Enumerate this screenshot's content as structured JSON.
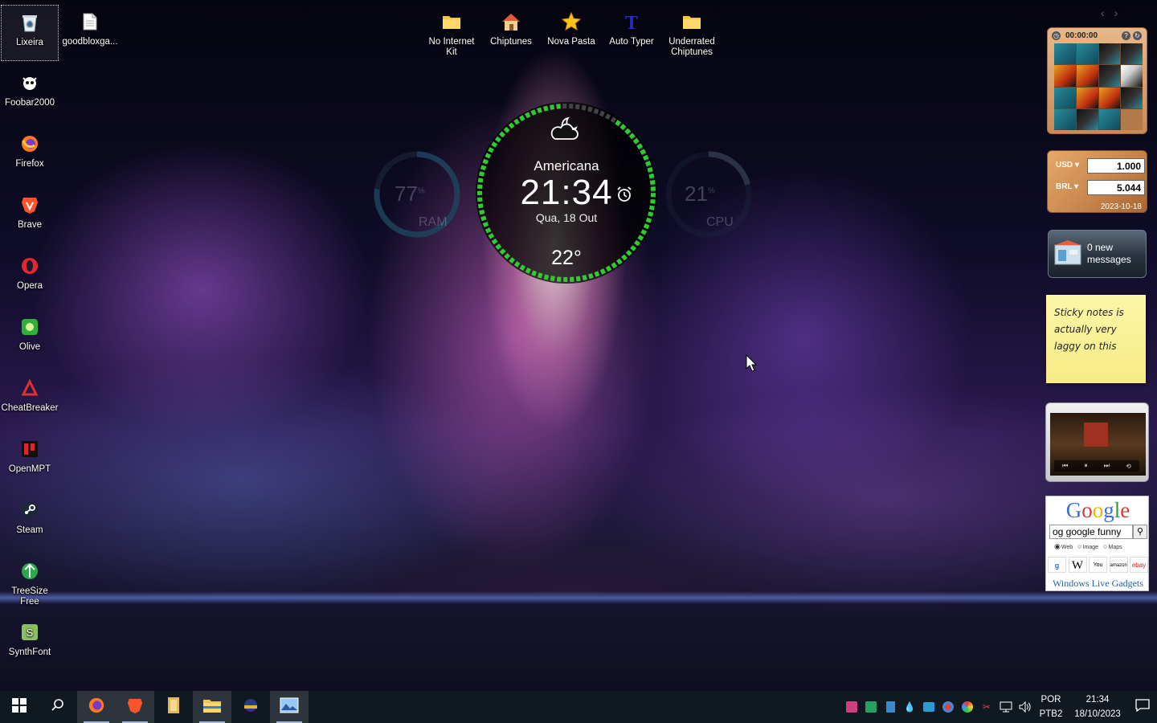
{
  "desktop_icons": [
    {
      "label": "Lixeira",
      "icon": "recycle-bin-icon"
    },
    {
      "label": "goodbloxga...",
      "icon": "file-icon"
    },
    {
      "label": "Foobar2000",
      "icon": "foobar-icon"
    },
    {
      "label": "Firefox",
      "icon": "firefox-icon"
    },
    {
      "label": "Brave",
      "icon": "brave-icon"
    },
    {
      "label": "Opera",
      "icon": "opera-icon"
    },
    {
      "label": "Olive",
      "icon": "olive-icon"
    },
    {
      "label": "CheatBreaker",
      "icon": "cheatbreaker-icon"
    },
    {
      "label": "OpenMPT",
      "icon": "openmpt-icon"
    },
    {
      "label": "Steam",
      "icon": "steam-icon"
    },
    {
      "label": "TreeSize Free",
      "icon": "treesize-icon"
    },
    {
      "label": "SynthFont",
      "icon": "synthfont-icon"
    },
    {
      "label": "No Internet Kit",
      "icon": "folder-icon"
    },
    {
      "label": "Chiptunes",
      "icon": "home-folder-icon"
    },
    {
      "label": "Nova Pasta",
      "icon": "star-icon"
    },
    {
      "label": "Auto Typer",
      "icon": "auto-typer-icon"
    },
    {
      "label": "Underrated Chiptunes",
      "icon": "folder-icon"
    }
  ],
  "clock_widget": {
    "city": "Americana",
    "time": "21:34",
    "date": "Qua, 18 Out",
    "temperature": "22°",
    "weather_icon": "partly-cloudy-night-icon",
    "ring_color": "#2ecc2e"
  },
  "ram_meter": {
    "value": "77",
    "unit": "%",
    "label": "RAM",
    "percent": 77
  },
  "cpu_meter": {
    "value": "21",
    "unit": "%",
    "label": "CPU",
    "percent": 21
  },
  "gadgets": {
    "puzzle": {
      "timer": "00:00:00"
    },
    "currency": {
      "from_code": "USD",
      "from_amount": "1.000",
      "to_code": "BRL",
      "to_amount": "5.044",
      "date": "2023-10-18"
    },
    "mail": {
      "line1": "0 new",
      "line2": "messages"
    },
    "sticky": {
      "text": "Sticky notes is actually very laggy on this"
    },
    "google": {
      "logo": "Google",
      "query": "og google funny",
      "options": [
        "Web",
        "Image",
        "Maps"
      ],
      "selected_option": "Web",
      "links": [
        "Google",
        "W",
        "YouTube",
        "amazon",
        "ebay"
      ],
      "footer": "Windows Live Gadgets"
    }
  },
  "taskbar": {
    "apps": [
      {
        "name": "Firefox",
        "icon": "firefox-icon",
        "active": true
      },
      {
        "name": "Brave",
        "icon": "brave-icon",
        "active": true
      },
      {
        "name": "Files",
        "icon": "file-cabinet-icon",
        "active": false
      },
      {
        "name": "File Explorer",
        "icon": "folder-icon",
        "active": true
      },
      {
        "name": "App",
        "icon": "app-icon",
        "active": false
      },
      {
        "name": "Image Viewer",
        "icon": "image-viewer-icon",
        "active": true
      }
    ],
    "tray": {
      "language_line1": "POR",
      "language_line2": "PTB2",
      "time": "21:34",
      "date": "18/10/2023"
    }
  }
}
